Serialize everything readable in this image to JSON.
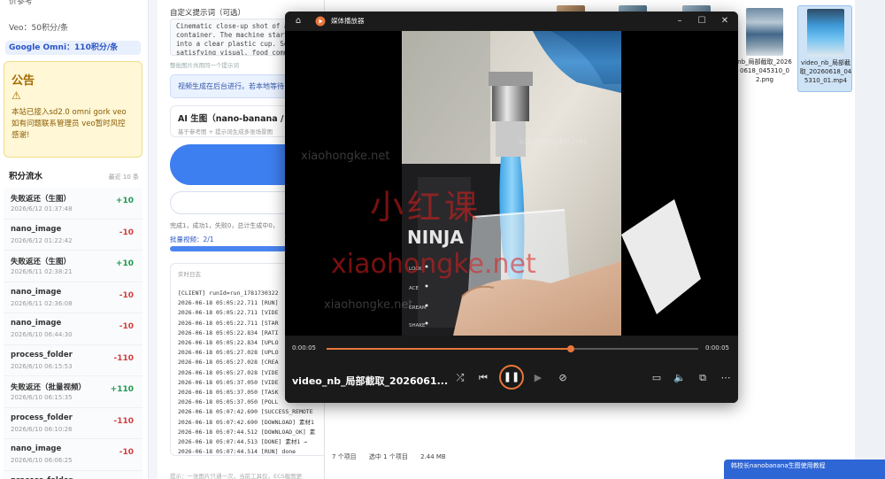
{
  "sidebar": {
    "header": "价参考",
    "prices": [
      {
        "label": "Veo：50积分/条",
        "active": false
      },
      {
        "label": "Google Omni：110积分/条",
        "active": true
      }
    ],
    "notice": {
      "title": "公告",
      "warning_icon": "warning-triangle-icon",
      "text": "本站已接入sd2.0 omni gork veo 如有问题联系管理员 veo暂时风控 感谢!"
    },
    "flow": {
      "title": "积分流水",
      "recent": "最近 10 条",
      "items": [
        {
          "name": "失败返还（生图）",
          "time": "2026/6/12 01:37:48",
          "amount": "+10",
          "type": "pos"
        },
        {
          "name": "nano_image",
          "time": "2026/6/12 01:22:42",
          "amount": "-10",
          "type": "neg"
        },
        {
          "name": "失败返还（生图）",
          "time": "2026/6/11 02:38:21",
          "amount": "+10",
          "type": "pos"
        },
        {
          "name": "nano_image",
          "time": "2026/6/11 02:36:08",
          "amount": "-10",
          "type": "neg"
        },
        {
          "name": "nano_image",
          "time": "2026/6/10 06:44:30",
          "amount": "-10",
          "type": "neg"
        },
        {
          "name": "process_folder",
          "time": "2026/6/10 06:15:53",
          "amount": "-110",
          "type": "neg"
        },
        {
          "name": "失败返还（批量视频）",
          "time": "2026/6/10 06:15:35",
          "amount": "+110",
          "type": "pos"
        },
        {
          "name": "process_folder",
          "time": "2026/6/10 06:10:26",
          "amount": "-110",
          "type": "neg"
        },
        {
          "name": "nano_image",
          "time": "2026/6/10 06:06:25",
          "amount": "-10",
          "type": "neg"
        },
        {
          "name": "process_folder",
          "time": "2026/6/10 06:02:11",
          "amount": "-110",
          "type": "neg"
        }
      ]
    }
  },
  "panel": {
    "prompt_label": "自定义提示词（可选）",
    "prompt_text": "Cinematic close-up shot of a\ncontainer. The machine starts\ninto a clear plastic cup. Sof\nsatisfying visual, food comme",
    "prompt_hint": "整批图片共用同一个提示词",
    "info_text": "视频生成在后台进行。若本地等待",
    "ai_title": "AI 生图（nano-banana / GPT",
    "ai_sub": "基于参考图 + 提示词生成多张场景图",
    "stats": "完成1，成功1，失败0，总计生成中0，",
    "batch": "批量视频：2/1",
    "progress_fraction": 1.0,
    "log_title": "实时日志",
    "log_lines": [
      "[CLIENT] runId=run_1781730322",
      "2026-06-18 05:05:22.711 [RUN]",
      "2026-06-18 05:05:22.711 [VIDE",
      "2026-06-18 05:05:22.711 [STAR",
      "2026-06-18 05:05:22.834 [RATI",
      "2026-06-18 05:05:22.834 [UPLO",
      "2026-06-18 05:05:27.028 [UPLO",
      "2026-06-18 05:05:27.028 [CREA",
      "2026-06-18 05:05:27.028 [VIDE",
      "2026-06-18 05:05:37.050 [VIDE",
      "2026-06-18 05:05:37.050 [TASK",
      "2026-06-18 05:05:37.050 [POLL",
      "2026-06-18 05:07:42.690 [SUCCESS_REMOTE",
      "2026-06-18 05:07:42.690 [DOWNLOAD] 素材1",
      "2026-06-18 05:07:44.512 [DOWNLOAD_OK] 素",
      "2026-06-18 05:07:44.513 [DONE] 素材1 →",
      "2026-06-18 05:07:44.514 [RUN] done"
    ],
    "footer": "提示：一张图片只通一次，当前工具仅，ECS截图更"
  },
  "explorer": {
    "files": [
      {
        "name": "nb_局部截取_20260618_045310_02.png",
        "selected": false
      },
      {
        "name": "video_nb_局部截取_20260618_045310_01.mp4",
        "selected": true
      }
    ],
    "status": {
      "count": "7 个项目",
      "selection": "选中 1 个项目",
      "size": "2.44 MB"
    }
  },
  "toast": {
    "text": "韩校长nanobanana生图使用教程"
  },
  "player": {
    "title": "媒体播放器",
    "current_time": "0:00:05",
    "total_time": "0:00:05",
    "progress_fraction": 0.657,
    "filename": "video_nb_局部截取_2026061...",
    "video": {
      "watermark_cn": "小红课",
      "watermark_en": "xiaohongke.net",
      "machine_brand": "NINJA",
      "machine_labels": [
        "LOCK",
        "ACE",
        "CREAM",
        "SHAKE"
      ]
    },
    "window_icons": {
      "home": "home-icon",
      "minimize": "minimize-icon",
      "maximize": "maximize-icon",
      "close": "close-icon"
    }
  }
}
